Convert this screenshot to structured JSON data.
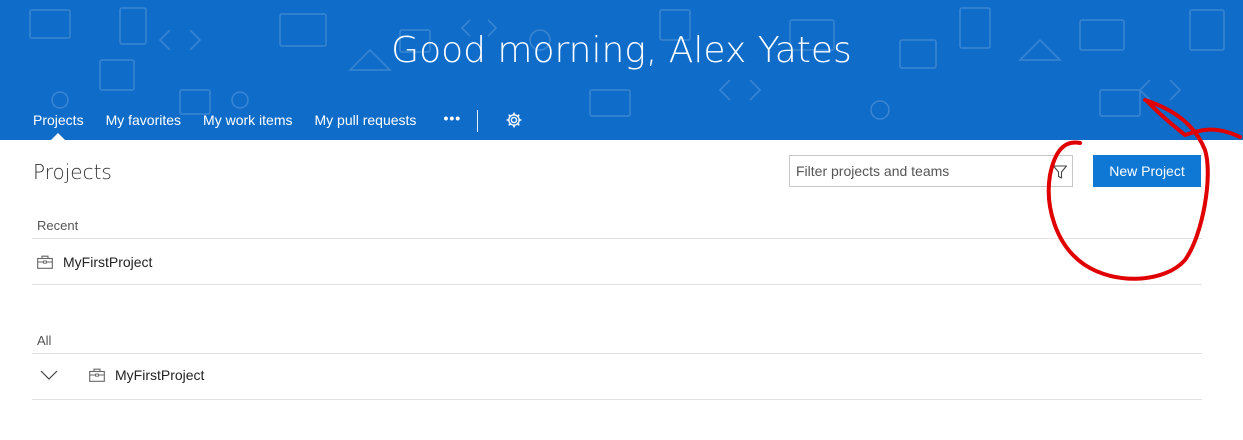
{
  "header": {
    "greeting": "Good morning, Alex Yates",
    "tabs": [
      {
        "label": "Projects",
        "selected": true
      },
      {
        "label": "My favorites",
        "selected": false
      },
      {
        "label": "My work items",
        "selected": false
      },
      {
        "label": "My pull requests",
        "selected": false
      }
    ],
    "more_label": "•••",
    "settings_icon": "gear-icon",
    "background_color": "#0f6cc9"
  },
  "main": {
    "title": "Projects",
    "filter_placeholder": "Filter projects and teams",
    "filter_value": "",
    "filter_icon": "funnel-icon",
    "new_project_label": "New Project",
    "accent_color": "#0f78d4",
    "recent": {
      "label": "Recent",
      "items": [
        {
          "name": "MyFirstProject",
          "icon": "briefcase-icon"
        }
      ]
    },
    "all": {
      "label": "All",
      "items": [
        {
          "name": "MyFirstProject",
          "icon": "briefcase-icon",
          "expander": "chevron-down-icon"
        }
      ]
    }
  },
  "annotation": {
    "shape": "red hand-drawn circle around New Project button",
    "color": "#e00000"
  }
}
